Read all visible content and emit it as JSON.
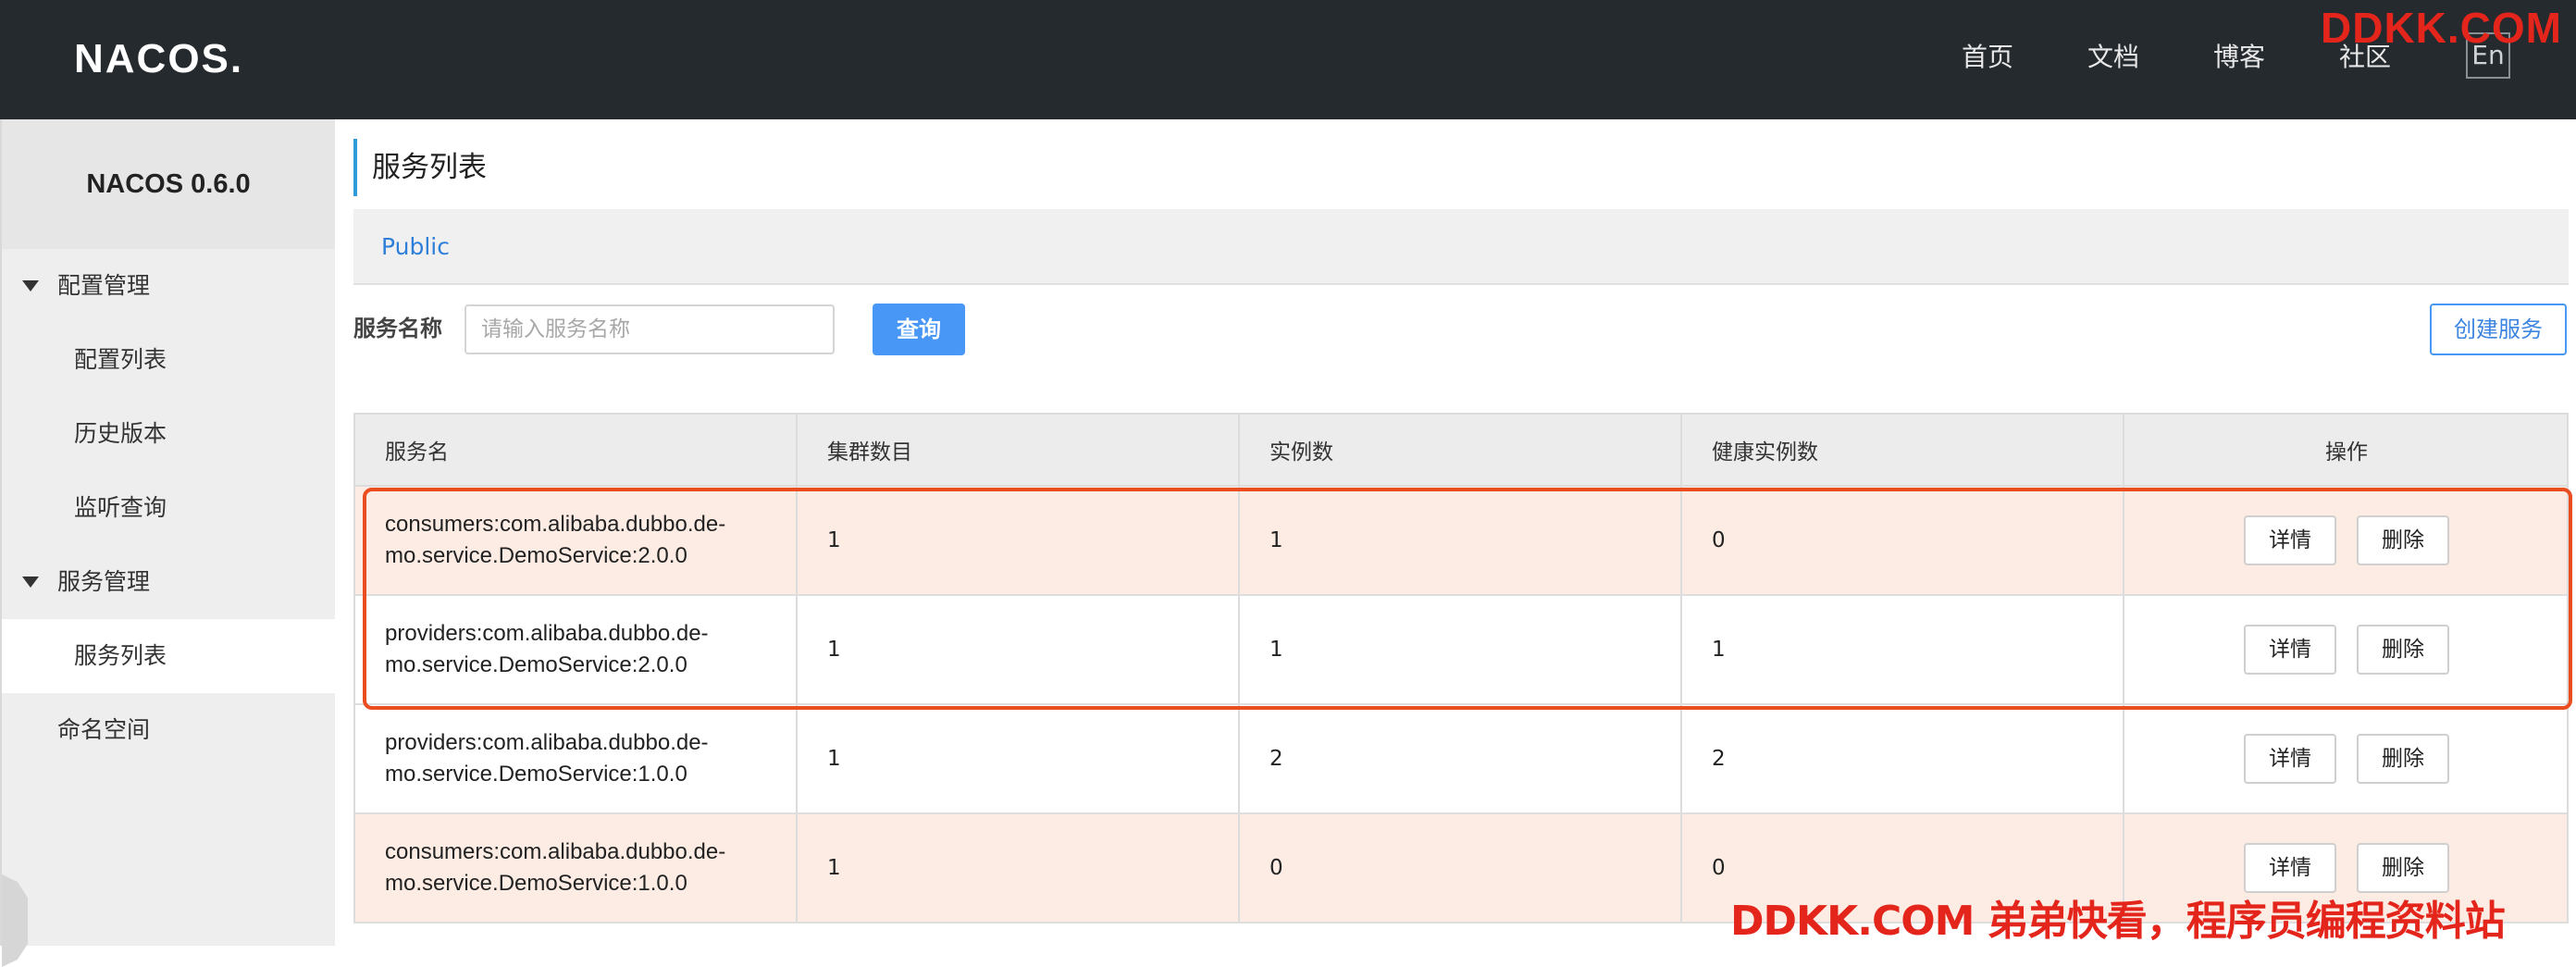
{
  "header": {
    "logo": "NACOS.",
    "nav": [
      "首页",
      "文档",
      "博客",
      "社区"
    ],
    "lang_button": "En"
  },
  "watermark": {
    "top": "DDKK.COM",
    "bottom": "DDKK.COM 弟弟快看，程序员编程资料站"
  },
  "sidebar": {
    "title": "NACOS 0.6.0",
    "items": [
      {
        "label": "配置管理"
      },
      {
        "label": "配置列表"
      },
      {
        "label": "历史版本"
      },
      {
        "label": "监听查询"
      },
      {
        "label": "服务管理"
      },
      {
        "label": "服务列表"
      },
      {
        "label": "命名空间"
      }
    ]
  },
  "main": {
    "title": "服务列表",
    "namespace": "Public",
    "search": {
      "label": "服务名称",
      "placeholder": "请输入服务名称",
      "value": "",
      "query_button": "查询"
    },
    "create_button": "创建服务"
  },
  "table": {
    "headers": [
      "服务名",
      "集群数目",
      "实例数",
      "健康实例数",
      "操作"
    ],
    "rows": [
      {
        "name_line1": "consumers:com.alibaba.dubbo.de-",
        "name_line2": "mo.service.DemoService:2.0.0",
        "clusters": "1",
        "instances": "1",
        "healthy": "0"
      },
      {
        "name_line1": "providers:com.alibaba.dubbo.de-",
        "name_line2": "mo.service.DemoService:2.0.0",
        "clusters": "1",
        "instances": "1",
        "healthy": "1"
      },
      {
        "name_line1": "providers:com.alibaba.dubbo.de-",
        "name_line2": "mo.service.DemoService:1.0.0",
        "clusters": "1",
        "instances": "2",
        "healthy": "2"
      },
      {
        "name_line1": "consumers:com.alibaba.dubbo.de-",
        "name_line2": "mo.service.DemoService:1.0.0",
        "clusters": "1",
        "instances": "0",
        "healthy": "0"
      }
    ],
    "actions": {
      "detail": "详情",
      "delete": "删除"
    }
  },
  "colors": {
    "header_bg": "#252a2f",
    "accent_blue": "#4896f5",
    "highlight_border": "#ea4d1f",
    "alt_row_bg": "#fdece4",
    "watermark_red": "#e3251b"
  }
}
